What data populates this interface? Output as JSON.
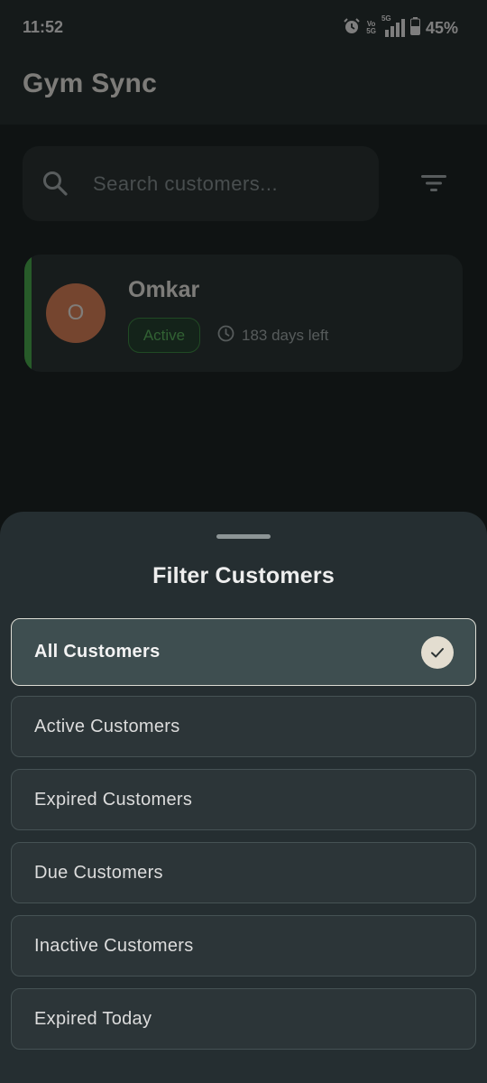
{
  "status_bar": {
    "time": "11:52",
    "volte": "Vo",
    "volte_sub": "5G",
    "network": "5G",
    "battery": "45%"
  },
  "app": {
    "title": "Gym Sync"
  },
  "search": {
    "placeholder": "Search customers..."
  },
  "customers": [
    {
      "name": "Omkar",
      "initial": "O",
      "status": "Active",
      "days_left": "183 days left",
      "status_color": "#4caf50",
      "avatar_color": "#e0845a"
    }
  ],
  "filter_sheet": {
    "title": "Filter Customers",
    "options": [
      {
        "label": "All Customers",
        "selected": true
      },
      {
        "label": "Active Customers",
        "selected": false
      },
      {
        "label": "Expired Customers",
        "selected": false
      },
      {
        "label": "Due Customers",
        "selected": false
      },
      {
        "label": "Inactive Customers",
        "selected": false
      },
      {
        "label": "Expired Today",
        "selected": false
      }
    ]
  },
  "icons": {
    "search": "search-icon",
    "filter": "filter-icon",
    "clock": "clock-icon",
    "check": "check-icon",
    "alarm": "alarm-icon",
    "signal": "signal-icon",
    "battery": "battery-icon"
  }
}
